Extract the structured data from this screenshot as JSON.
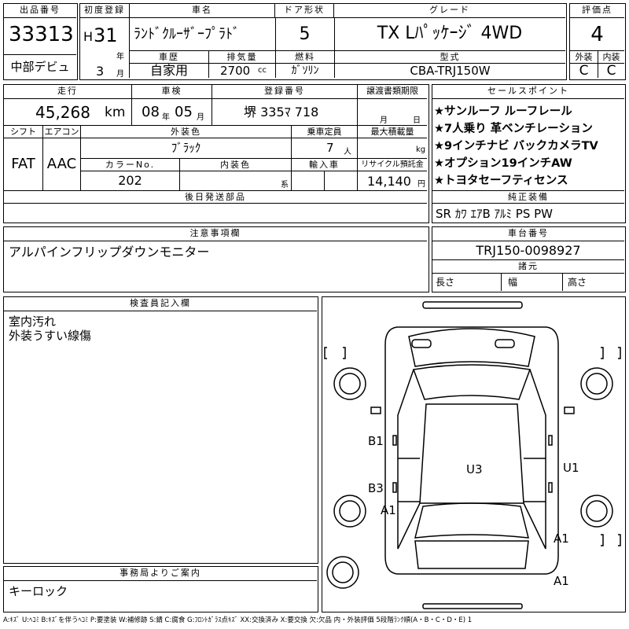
{
  "lot": {
    "header": "出品番号",
    "number": "33313",
    "badge": "中部デビュ"
  },
  "first_reg": {
    "header": "初度登録",
    "era": "H",
    "year": "31",
    "year_unit": "年",
    "month": "3",
    "month_unit": "月"
  },
  "car_name": {
    "header": "車名",
    "value": "ﾗﾝﾄﾞｸﾙｰｻﾞｰﾌﾟﾗﾄﾞ"
  },
  "door": {
    "header": "ドア形状",
    "value": "5"
  },
  "grade": {
    "header": "グレード",
    "value": "TX Lﾊﾟｯｹｰｼﾞ 4WD"
  },
  "score": {
    "header": "評価点",
    "value": "4",
    "ext_label": "外装",
    "int_label": "内装",
    "ext": "C",
    "int": "C"
  },
  "history": {
    "header": "車歴",
    "value": "自家用"
  },
  "displacement": {
    "header": "排気量",
    "value": "2700",
    "unit": "cc"
  },
  "fuel": {
    "header": "燃料",
    "value": "ｶﾞｿﾘﾝ"
  },
  "model": {
    "header": "型式",
    "value": "CBA-TRJ150W"
  },
  "mileage": {
    "header": "走行",
    "value": "45,268",
    "unit": "km"
  },
  "inspection": {
    "header": "車検",
    "year": "08",
    "year_unit": "年",
    "month": "05",
    "month_unit": "月"
  },
  "plate": {
    "header": "登録番号",
    "value": "堺 335ﾏ 718"
  },
  "transfer": {
    "header": "譲渡書類期限",
    "month_unit": "月",
    "day_unit": "日"
  },
  "shift": {
    "header": "シフト",
    "value": "FAT"
  },
  "aircon": {
    "header": "エアコン",
    "value": "AAC"
  },
  "exterior_color": {
    "header": "外装色",
    "value": "ﾌﾞﾗｯｸ"
  },
  "capacity": {
    "header": "乗車定員",
    "value": "7",
    "unit": "人"
  },
  "max_load": {
    "header": "最大積載量",
    "unit": "kg"
  },
  "color_no": {
    "header": "カラーNo.",
    "value": "202"
  },
  "interior_color": {
    "header": "内装色",
    "unit": "系"
  },
  "import": {
    "header": "輸入車"
  },
  "recycle": {
    "header": "リサイクル預託金",
    "value": "14,140",
    "unit": "円"
  },
  "later_parts": {
    "header": "後日発送部品"
  },
  "sales_points": {
    "header": "セールスポイント",
    "items": [
      "★サンルーフ ルーフレール",
      "★7人乗り 革ベンチレーション",
      "★9インチナビ バックカメラTV",
      "★オプション19インチAW",
      "★トヨタセーフティセンス"
    ]
  },
  "equipment": {
    "header": "純正装備",
    "value": "SR ｶﾜ ｴｱB ｱﾙﾐ PS PW"
  },
  "notes": {
    "header": "注意事項欄",
    "text": "アルパインフリップダウンモニター"
  },
  "chassis": {
    "header": "車台番号",
    "value": "TRJ150-0098927"
  },
  "specs": {
    "header": "諸元",
    "length": "長さ",
    "width": "幅",
    "height": "高さ"
  },
  "inspector": {
    "header": "検査員記入欄",
    "lines": [
      "室内汚れ",
      "外装うすい線傷"
    ]
  },
  "office": {
    "header": "事務局よりご案内",
    "text": "キーロック"
  },
  "diagram": {
    "marks": [
      "B1",
      "B3",
      "A1",
      "U3",
      "U1",
      "A1",
      "A1"
    ]
  },
  "legend": "A:ｷｽﾞ U:ﾍｺﾐ B:ｷｽﾞを伴うﾍｺﾐ P:要塗装 W:補修跡 S:錆 C:腐食 G:ﾌﾛﾝﾄｶﾞﾗｽ点ｷｽﾞ XX:交換済み X:要交換 欠:欠品 内・外装評価 5段階ﾗﾝｸ順(A・B・C・D・E) 1"
}
